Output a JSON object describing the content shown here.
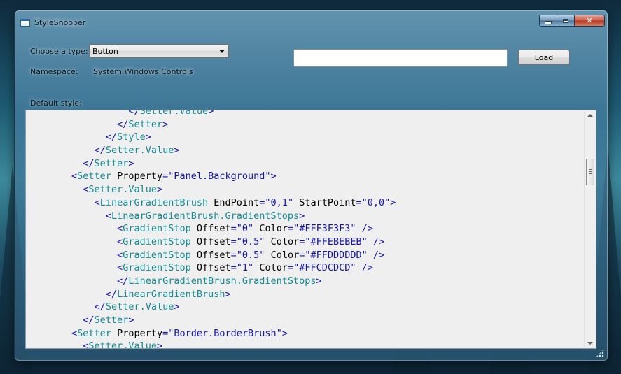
{
  "window": {
    "title": "StyleSnooper"
  },
  "form": {
    "type_label": "Choose a type:",
    "type_selected": "Button",
    "namespace_label": "Namespace:",
    "namespace_value": "System.Windows.Controls",
    "default_style_label": "Default style:",
    "path_value": "",
    "load_label": "Load"
  },
  "code_lines": [
    {
      "indent": 16,
      "parts": [
        {
          "k": "t",
          "s": "</"
        },
        {
          "k": "n",
          "s": "Setter.Value"
        },
        {
          "k": "t",
          "s": ">"
        }
      ]
    },
    {
      "indent": 14,
      "parts": [
        {
          "k": "t",
          "s": "</"
        },
        {
          "k": "n",
          "s": "Setter"
        },
        {
          "k": "t",
          "s": ">"
        }
      ]
    },
    {
      "indent": 12,
      "parts": [
        {
          "k": "t",
          "s": "</"
        },
        {
          "k": "n",
          "s": "Style"
        },
        {
          "k": "t",
          "s": ">"
        }
      ]
    },
    {
      "indent": 10,
      "parts": [
        {
          "k": "t",
          "s": "</"
        },
        {
          "k": "n",
          "s": "Setter.Value"
        },
        {
          "k": "t",
          "s": ">"
        }
      ]
    },
    {
      "indent": 8,
      "parts": [
        {
          "k": "t",
          "s": "</"
        },
        {
          "k": "n",
          "s": "Setter"
        },
        {
          "k": "t",
          "s": ">"
        }
      ]
    },
    {
      "indent": 6,
      "parts": [
        {
          "k": "t",
          "s": "<"
        },
        {
          "k": "n",
          "s": "Setter"
        },
        {
          "k": "a",
          "s": " Property"
        },
        {
          "k": "t",
          "s": "=\""
        },
        {
          "k": "v",
          "s": "Panel.Background"
        },
        {
          "k": "t",
          "s": "\">"
        }
      ]
    },
    {
      "indent": 8,
      "parts": [
        {
          "k": "t",
          "s": "<"
        },
        {
          "k": "n",
          "s": "Setter.Value"
        },
        {
          "k": "t",
          "s": ">"
        }
      ]
    },
    {
      "indent": 10,
      "parts": [
        {
          "k": "t",
          "s": "<"
        },
        {
          "k": "n",
          "s": "LinearGradientBrush"
        },
        {
          "k": "a",
          "s": " EndPoint"
        },
        {
          "k": "t",
          "s": "=\""
        },
        {
          "k": "v",
          "s": "0,1"
        },
        {
          "k": "t",
          "s": "\""
        },
        {
          "k": "a",
          "s": " StartPoint"
        },
        {
          "k": "t",
          "s": "=\""
        },
        {
          "k": "v",
          "s": "0,0"
        },
        {
          "k": "t",
          "s": "\">"
        }
      ]
    },
    {
      "indent": 12,
      "parts": [
        {
          "k": "t",
          "s": "<"
        },
        {
          "k": "n",
          "s": "LinearGradientBrush.GradientStops"
        },
        {
          "k": "t",
          "s": ">"
        }
      ]
    },
    {
      "indent": 14,
      "parts": [
        {
          "k": "t",
          "s": "<"
        },
        {
          "k": "n",
          "s": "GradientStop"
        },
        {
          "k": "a",
          "s": " Offset"
        },
        {
          "k": "t",
          "s": "=\""
        },
        {
          "k": "v",
          "s": "0"
        },
        {
          "k": "t",
          "s": "\""
        },
        {
          "k": "a",
          "s": " Color"
        },
        {
          "k": "t",
          "s": "=\""
        },
        {
          "k": "v",
          "s": "#FFF3F3F3"
        },
        {
          "k": "t",
          "s": "\" />"
        }
      ]
    },
    {
      "indent": 14,
      "parts": [
        {
          "k": "t",
          "s": "<"
        },
        {
          "k": "n",
          "s": "GradientStop"
        },
        {
          "k": "a",
          "s": " Offset"
        },
        {
          "k": "t",
          "s": "=\""
        },
        {
          "k": "v",
          "s": "0.5"
        },
        {
          "k": "t",
          "s": "\""
        },
        {
          "k": "a",
          "s": " Color"
        },
        {
          "k": "t",
          "s": "=\""
        },
        {
          "k": "v",
          "s": "#FFEBEBEB"
        },
        {
          "k": "t",
          "s": "\" />"
        }
      ]
    },
    {
      "indent": 14,
      "parts": [
        {
          "k": "t",
          "s": "<"
        },
        {
          "k": "n",
          "s": "GradientStop"
        },
        {
          "k": "a",
          "s": " Offset"
        },
        {
          "k": "t",
          "s": "=\""
        },
        {
          "k": "v",
          "s": "0.5"
        },
        {
          "k": "t",
          "s": "\""
        },
        {
          "k": "a",
          "s": " Color"
        },
        {
          "k": "t",
          "s": "=\""
        },
        {
          "k": "v",
          "s": "#FFDDDDDD"
        },
        {
          "k": "t",
          "s": "\" />"
        }
      ]
    },
    {
      "indent": 14,
      "parts": [
        {
          "k": "t",
          "s": "<"
        },
        {
          "k": "n",
          "s": "GradientStop"
        },
        {
          "k": "a",
          "s": " Offset"
        },
        {
          "k": "t",
          "s": "=\""
        },
        {
          "k": "v",
          "s": "1"
        },
        {
          "k": "t",
          "s": "\""
        },
        {
          "k": "a",
          "s": " Color"
        },
        {
          "k": "t",
          "s": "=\""
        },
        {
          "k": "v",
          "s": "#FFCDCDCD"
        },
        {
          "k": "t",
          "s": "\" />"
        }
      ]
    },
    {
      "indent": 14,
      "parts": [
        {
          "k": "t",
          "s": "</"
        },
        {
          "k": "n",
          "s": "LinearGradientBrush.GradientStops"
        },
        {
          "k": "t",
          "s": ">"
        }
      ]
    },
    {
      "indent": 12,
      "parts": [
        {
          "k": "t",
          "s": "</"
        },
        {
          "k": "n",
          "s": "LinearGradientBrush"
        },
        {
          "k": "t",
          "s": ">"
        }
      ]
    },
    {
      "indent": 10,
      "parts": [
        {
          "k": "t",
          "s": "</"
        },
        {
          "k": "n",
          "s": "Setter.Value"
        },
        {
          "k": "t",
          "s": ">"
        }
      ]
    },
    {
      "indent": 8,
      "parts": [
        {
          "k": "t",
          "s": "</"
        },
        {
          "k": "n",
          "s": "Setter"
        },
        {
          "k": "t",
          "s": ">"
        }
      ]
    },
    {
      "indent": 6,
      "parts": [
        {
          "k": "t",
          "s": "<"
        },
        {
          "k": "n",
          "s": "Setter"
        },
        {
          "k": "a",
          "s": " Property"
        },
        {
          "k": "t",
          "s": "=\""
        },
        {
          "k": "v",
          "s": "Border.BorderBrush"
        },
        {
          "k": "t",
          "s": "\">"
        }
      ]
    },
    {
      "indent": 8,
      "parts": [
        {
          "k": "t",
          "s": "<"
        },
        {
          "k": "n",
          "s": "Setter.Value"
        },
        {
          "k": "t",
          "s": ">"
        }
      ]
    }
  ],
  "scrollbar": {
    "position_fraction": 0.2
  },
  "colors": {
    "tag": "#1515b5",
    "element": "#128c96",
    "attribute": "#000000",
    "value": "#1515b5",
    "editor_bg": "#efefef"
  }
}
